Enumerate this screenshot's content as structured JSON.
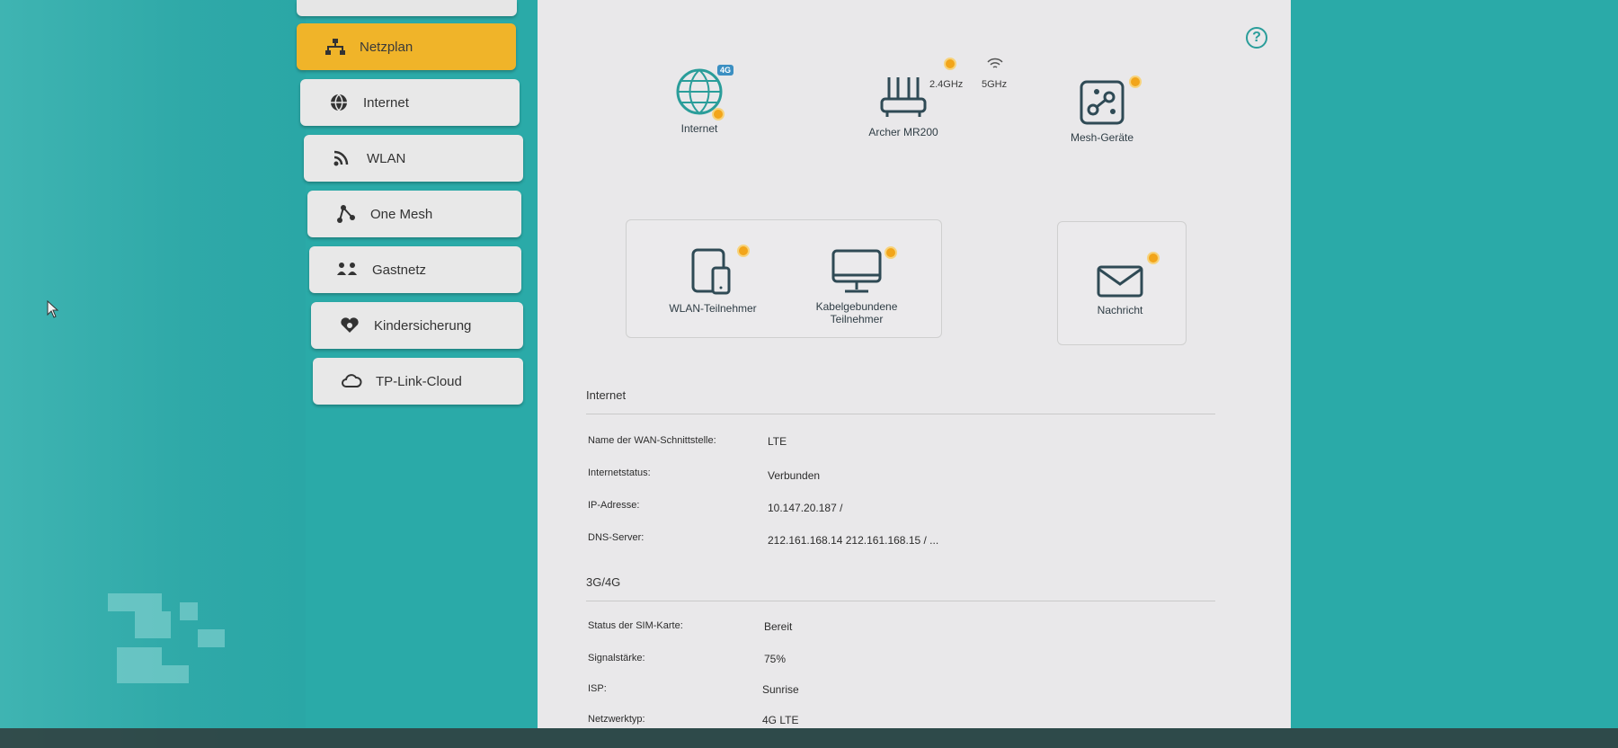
{
  "sidebar": {
    "items": [
      {
        "label": "Netzplan",
        "icon": "network-map-icon",
        "active": true
      },
      {
        "label": "Internet",
        "icon": "globe-icon",
        "active": false
      },
      {
        "label": "WLAN",
        "icon": "wifi-icon",
        "active": false
      },
      {
        "label": "One Mesh",
        "icon": "mesh-icon",
        "active": false
      },
      {
        "label": "Gastnetz",
        "icon": "guests-icon",
        "active": false
      },
      {
        "label": "Kindersicherung",
        "icon": "parental-heart-icon",
        "active": false
      },
      {
        "label": "TP-Link-Cloud",
        "icon": "cloud-icon",
        "active": false
      }
    ]
  },
  "network_map": {
    "internet": {
      "label": "Internet",
      "badge": "4G"
    },
    "router": {
      "label": "Archer MR200",
      "freq_24": "2.4GHz",
      "freq_5": "5GHz"
    },
    "mesh": {
      "label": "Mesh-Geräte"
    },
    "wlan_clients": {
      "label": "WLAN-Teilnehmer"
    },
    "wired_clients": {
      "label_line1": "Kabelgebundene",
      "label_line2": "Teilnehmer"
    },
    "message": {
      "label": "Nachricht"
    }
  },
  "internet_section": {
    "title": "Internet",
    "rows": [
      {
        "label": "Name der WAN-Schnittstelle:",
        "value": "LTE"
      },
      {
        "label": "Internetstatus:",
        "value": "Verbunden"
      },
      {
        "label": "IP-Adresse:",
        "value": "10.147.20.187 /"
      },
      {
        "label": "DNS-Server:",
        "value": "212.161.168.14 212.161.168.15 / ..."
      }
    ]
  },
  "lte_section": {
    "title": "3G/4G",
    "rows": [
      {
        "label": "Status der SIM-Karte:",
        "value": "Bereit"
      },
      {
        "label": "Signalstärke:",
        "value": "75%"
      },
      {
        "label": "ISP:",
        "value": "Sunrise"
      },
      {
        "label": "Netzwerktyp:",
        "value": "4G LTE"
      }
    ]
  },
  "colors": {
    "accent": "#f0b429",
    "teal": "#2aaaa8",
    "icon": "#2f4a55",
    "badge": "#f2a51a"
  }
}
